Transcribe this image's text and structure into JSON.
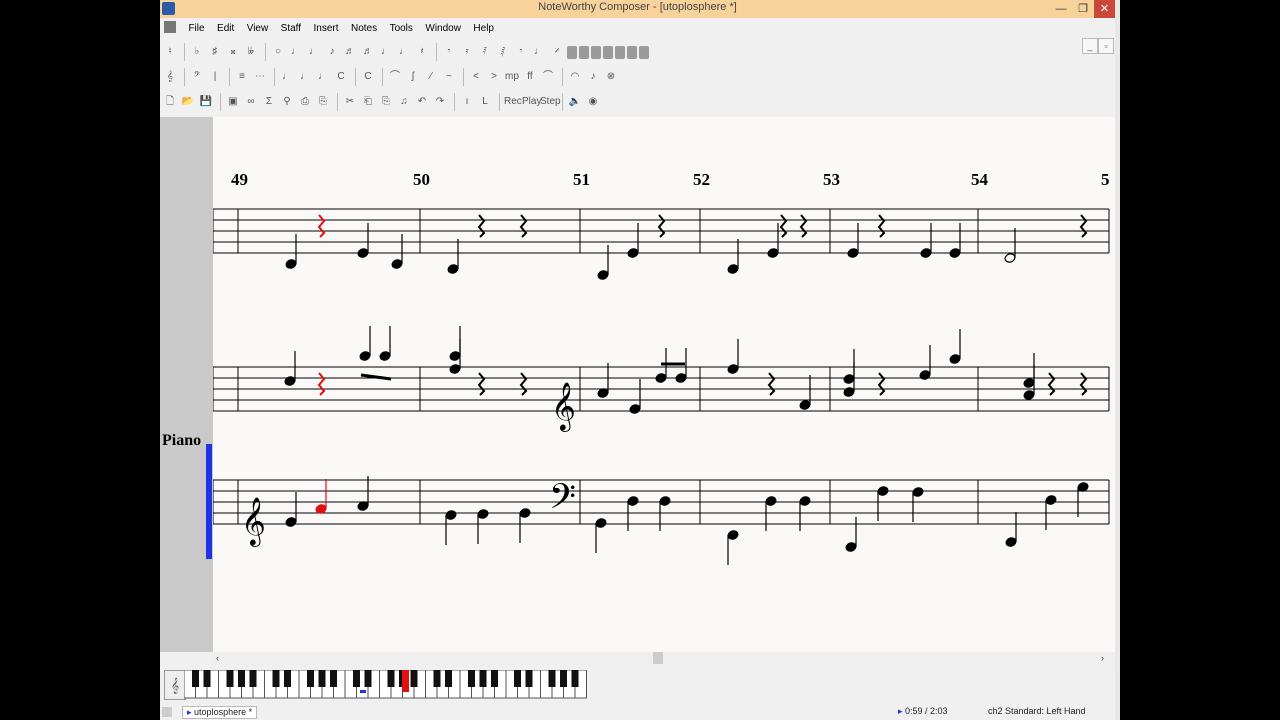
{
  "window": {
    "title": "NoteWorthy Composer - [utoplosphere *]",
    "min_glyph": "—",
    "max_glyph": "❐",
    "close_glyph": "✕"
  },
  "menu": [
    "File",
    "Edit",
    "View",
    "Staff",
    "Insert",
    "Notes",
    "Tools",
    "Window",
    "Help"
  ],
  "toolbar": {
    "row1": [
      "♮",
      "♭",
      "♯",
      "𝄪",
      "𝄫",
      "○",
      "♩",
      "♩",
      "♪",
      "♬",
      "♬",
      "♩",
      "♩",
      "𝄽",
      "𝄾",
      "𝄿",
      "𝅀",
      "𝅁",
      "𝄾",
      "♩",
      "𝄎"
    ],
    "row2": [
      "𝄞",
      "𝄢",
      "|",
      "≡",
      "⋯",
      "♩",
      "♩",
      "♩",
      "C",
      "C",
      "⌒",
      "ʃ",
      "⁄",
      "~",
      "<",
      ">",
      "mp",
      "ff",
      "⌒",
      "◠",
      "♪",
      "⊗"
    ],
    "row3": [
      "🗋",
      "📂",
      "💾",
      "▣",
      "∞",
      "Σ",
      "⚲",
      "⎙",
      "⎘",
      "✂",
      "⎗",
      "⎘",
      "♫",
      "↶",
      "↷",
      "ı",
      "L",
      "Rec",
      "Play",
      "Step",
      "🔈",
      "◉"
    ]
  },
  "score": {
    "measure_numbers": [
      "49",
      "50",
      "51",
      "52",
      "53",
      "54",
      "5"
    ],
    "instrument_label": "Piano"
  },
  "keyboard": {
    "white_keys": 35
  },
  "statusbar": {
    "tab_label": "utoplosphere *",
    "position": "0:59 / 2:03",
    "staff_info": "ch2 Standard: Left Hand"
  },
  "colors": {
    "titlebar": "#f7d29a",
    "selected_note": "#e01010",
    "staff_cursor": "#1c33e6",
    "canvas_bg": "#fbf8f8"
  }
}
